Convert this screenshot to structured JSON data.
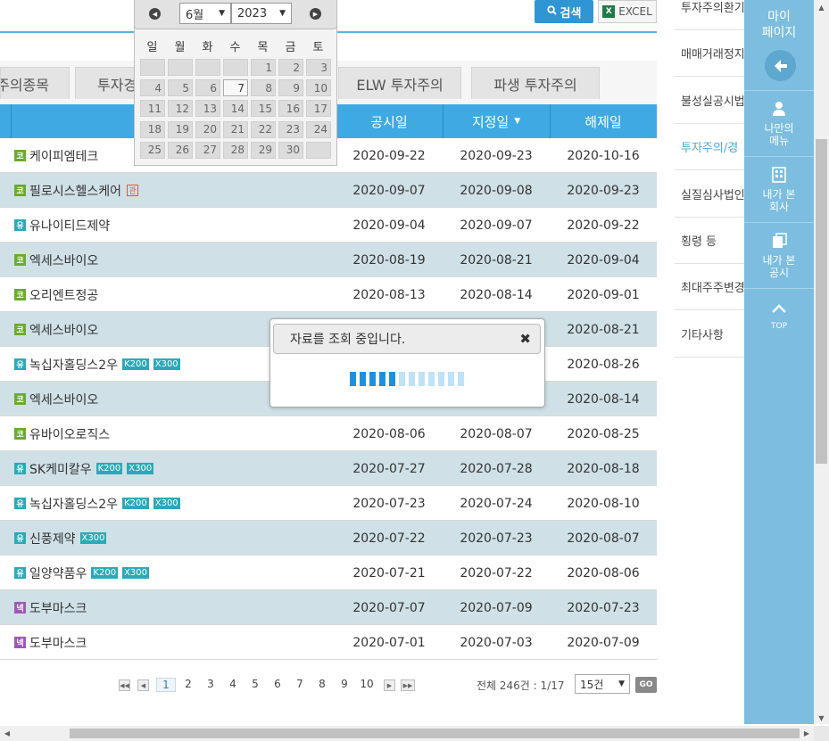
{
  "toolbar": {
    "search_label": "검색",
    "excel_label": "EXCEL"
  },
  "tabs": [
    {
      "label": "주의종목"
    },
    {
      "label": "투자경"
    },
    {
      "label": "ELW 투자주의"
    },
    {
      "label": "파생 투자주의"
    }
  ],
  "table": {
    "headers": {
      "announce": "공시일",
      "designate": "지정일",
      "release": "해제일"
    },
    "rows": [
      {
        "market": "코",
        "name": "케이피엠테크",
        "tags": [],
        "gwan": false,
        "announce": "2020-09-22",
        "designate": "2020-09-23",
        "release": "2020-10-16"
      },
      {
        "market": "코",
        "name": "필로시스헬스케어",
        "tags": [],
        "gwan": true,
        "announce": "2020-09-07",
        "designate": "2020-09-08",
        "release": "2020-09-23"
      },
      {
        "market": "유",
        "name": "유나이티드제약",
        "tags": [],
        "gwan": false,
        "announce": "2020-09-04",
        "designate": "2020-09-07",
        "release": "2020-09-22"
      },
      {
        "market": "코",
        "name": "엑세스바이오",
        "tags": [],
        "gwan": false,
        "announce": "2020-08-19",
        "designate": "2020-08-21",
        "release": "2020-09-04"
      },
      {
        "market": "코",
        "name": "오리엔트정공",
        "tags": [],
        "gwan": false,
        "announce": "2020-08-13",
        "designate": "2020-08-14",
        "release": "2020-09-01"
      },
      {
        "market": "코",
        "name": "엑세스바이오",
        "tags": [],
        "gwan": false,
        "announce": "",
        "designate": "",
        "release": "2020-08-21"
      },
      {
        "market": "유",
        "name": "녹십자홀딩스2우",
        "tags": [
          "K200",
          "X300"
        ],
        "gwan": false,
        "announce": "",
        "designate": "",
        "release": "2020-08-26"
      },
      {
        "market": "코",
        "name": "엑세스바이오",
        "tags": [],
        "gwan": false,
        "announce": "",
        "designate": "",
        "release": "2020-08-14"
      },
      {
        "market": "코",
        "name": "유바이오로직스",
        "tags": [],
        "gwan": false,
        "announce": "2020-08-06",
        "designate": "2020-08-07",
        "release": "2020-08-25"
      },
      {
        "market": "유",
        "name": "SK케미칼우",
        "tags": [
          "K200",
          "X300"
        ],
        "gwan": false,
        "announce": "2020-07-27",
        "designate": "2020-07-28",
        "release": "2020-08-18"
      },
      {
        "market": "유",
        "name": "녹십자홀딩스2우",
        "tags": [
          "K200",
          "X300"
        ],
        "gwan": false,
        "announce": "2020-07-23",
        "designate": "2020-07-24",
        "release": "2020-08-10"
      },
      {
        "market": "유",
        "name": "신풍제약",
        "tags": [
          "X300"
        ],
        "gwan": false,
        "announce": "2020-07-22",
        "designate": "2020-07-23",
        "release": "2020-08-07"
      },
      {
        "market": "유",
        "name": "일양약품우",
        "tags": [
          "K200",
          "X300"
        ],
        "gwan": false,
        "announce": "2020-07-21",
        "designate": "2020-07-22",
        "release": "2020-08-06"
      },
      {
        "market": "넥",
        "name": "도부마스크",
        "tags": [],
        "gwan": false,
        "announce": "2020-07-07",
        "designate": "2020-07-09",
        "release": "2020-07-23"
      },
      {
        "market": "넥",
        "name": "도부마스크",
        "tags": [],
        "gwan": false,
        "announce": "2020-07-01",
        "designate": "2020-07-03",
        "release": "2020-07-09"
      }
    ],
    "gwan_label": "관"
  },
  "pagination": {
    "pages": [
      "1",
      "2",
      "3",
      "4",
      "5",
      "6",
      "7",
      "8",
      "9",
      "10"
    ],
    "current": "1",
    "total_text": "전체 246건 : 1/17",
    "per_page": "15건",
    "go_label": "GO"
  },
  "side_menu": [
    {
      "label": "투자주의환기",
      "active": false
    },
    {
      "label": "매매거래정지",
      "active": false
    },
    {
      "label": "불성실공시법",
      "active": false
    },
    {
      "label": "투자주의/경",
      "active": true
    },
    {
      "label": "실질심사법인",
      "active": false
    },
    {
      "label": "횡령 등",
      "active": false
    },
    {
      "label": "최대주주변경",
      "active": false
    },
    {
      "label": "기타사항",
      "active": false
    }
  ],
  "quick_menu": {
    "title": "마이\n페이지",
    "my_menu": "나만의\n메뉴",
    "my_company": "내가 본\n회사",
    "my_disclosure": "내가 본\n공시",
    "top": "TOP"
  },
  "calendar": {
    "month": "6월",
    "year": "2023",
    "weekdays": [
      "일",
      "월",
      "화",
      "수",
      "목",
      "금",
      "토"
    ],
    "today": "7",
    "weeks": [
      [
        "",
        "",
        "",
        "",
        "1",
        "2",
        "3"
      ],
      [
        "4",
        "5",
        "6",
        "7",
        "8",
        "9",
        "10"
      ],
      [
        "11",
        "12",
        "13",
        "14",
        "15",
        "16",
        "17"
      ],
      [
        "18",
        "19",
        "20",
        "21",
        "22",
        "23",
        "24"
      ],
      [
        "25",
        "26",
        "27",
        "28",
        "29",
        "30",
        ""
      ]
    ]
  },
  "loading": {
    "message": "자료를 조회 중입니다.",
    "progress": 0.4,
    "segments": 12
  },
  "colors": {
    "accent": "#3ea9e2",
    "market_kosdaq": "#6aab2e",
    "market_kospi": "#2aaab8",
    "market_konex": "#9b59b6",
    "quick_menu_bg": "#7cbde0"
  }
}
